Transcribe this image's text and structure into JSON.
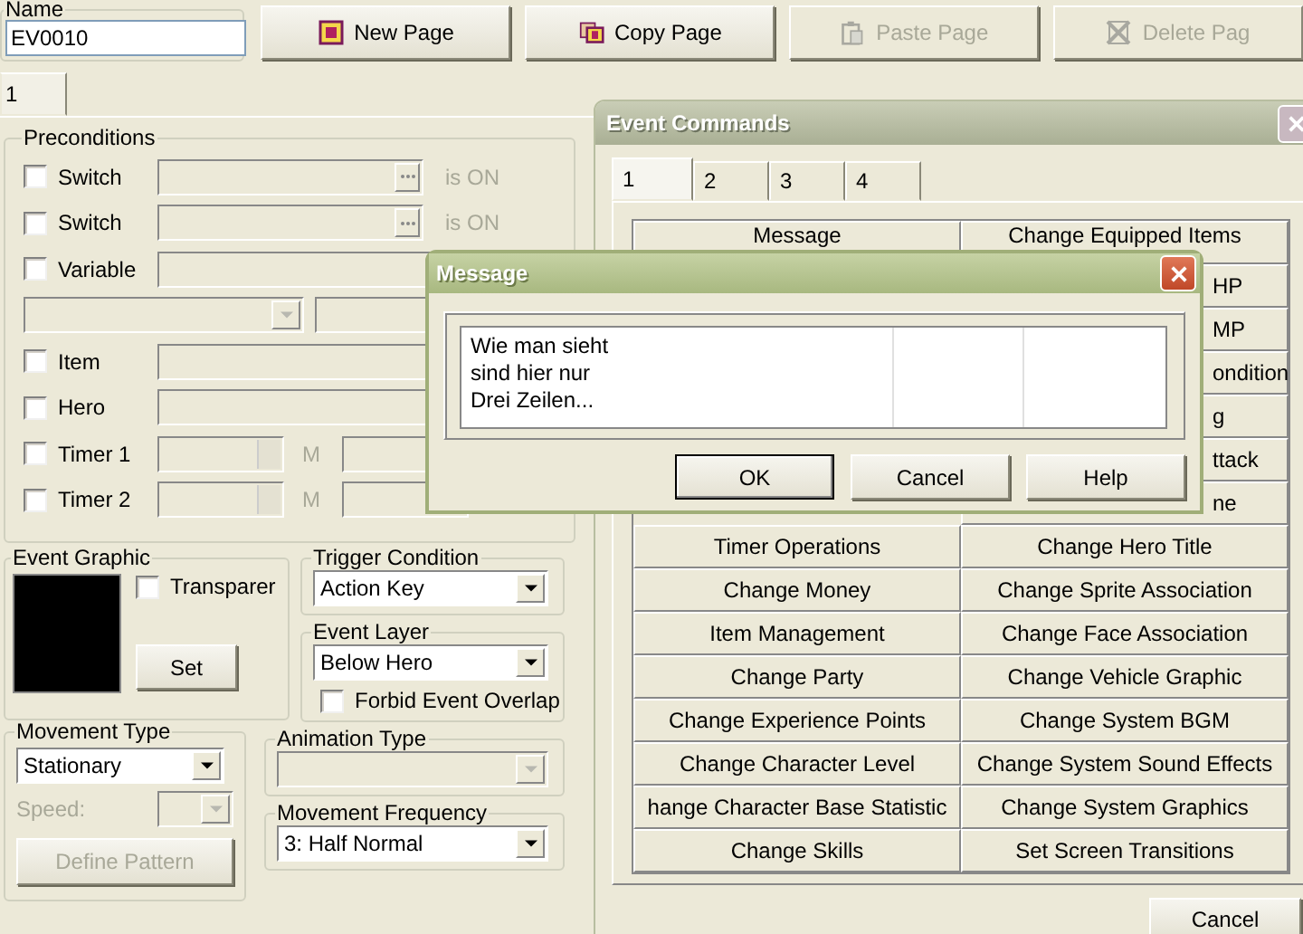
{
  "editor": {
    "name_label": "Name",
    "name_value": "EV0010",
    "toolbar": [
      {
        "label": "New Page",
        "disabled": false
      },
      {
        "label": "Copy Page",
        "disabled": false
      },
      {
        "label": "Paste Page",
        "disabled": true
      },
      {
        "label": "Delete Pag",
        "disabled": true
      }
    ],
    "page_tabs": [
      {
        "label": "1",
        "selected": true
      }
    ],
    "preconditions": {
      "title": "Preconditions",
      "rows": [
        {
          "kind": "switch",
          "label": "Switch",
          "checked": false,
          "suffix": "is ON"
        },
        {
          "kind": "switch",
          "label": "Switch",
          "checked": false,
          "suffix": "is ON"
        },
        {
          "kind": "field",
          "label": "Variable",
          "checked": false
        },
        {
          "kind": "compare"
        },
        {
          "kind": "field",
          "label": "Item",
          "checked": false
        },
        {
          "kind": "field",
          "label": "Hero",
          "checked": false
        },
        {
          "kind": "timer",
          "label": "Timer 1",
          "checked": false,
          "unit": "M"
        },
        {
          "kind": "timer",
          "label": "Timer 2",
          "checked": false,
          "unit": "M"
        }
      ]
    },
    "event_graphic": {
      "title": "Event Graphic",
      "transparent_label": "Transparer",
      "transparent_checked": false,
      "set_label": "Set"
    },
    "trigger_condition": {
      "title": "Trigger Condition",
      "value": "Action Key"
    },
    "event_layer": {
      "title": "Event Layer",
      "value": "Below Hero",
      "overlap_label": "Forbid Event Overlap",
      "overlap_checked": false
    },
    "movement_type": {
      "title": "Movement Type",
      "value": "Stationary",
      "speed_label": "Speed:",
      "pattern_label": "Define Pattern"
    },
    "animation_type": {
      "title": "Animation Type"
    },
    "movement_frequency": {
      "title": "Movement Frequency",
      "value": "3: Half Normal"
    }
  },
  "event_commands": {
    "title": "Event Commands",
    "tabs": [
      {
        "label": "1",
        "selected": true
      },
      {
        "label": "2",
        "selected": false
      },
      {
        "label": "3",
        "selected": false
      },
      {
        "label": "4",
        "selected": false
      }
    ],
    "rows": [
      {
        "left": "Message",
        "right": "Change Equipped Items"
      },
      {
        "right": "HP"
      },
      {
        "right": "MP"
      },
      {
        "right": "ondition"
      },
      {
        "right": "g"
      },
      {
        "right": "ttack"
      },
      {
        "right": "ne"
      },
      {
        "left": "Timer Operations",
        "right": "Change Hero Title"
      },
      {
        "left": "Change Money",
        "right": "Change Sprite Association"
      },
      {
        "left": "Item Management",
        "right": "Change Face Association"
      },
      {
        "left": "Change Party",
        "right": "Change Vehicle Graphic"
      },
      {
        "left": "Change Experience Points",
        "right": "Change System BGM"
      },
      {
        "left": "Change Character Level",
        "right": "Change System Sound Effects"
      },
      {
        "left": "hange Character Base Statistic",
        "right": "Change System Graphics"
      },
      {
        "left": "Change Skills",
        "right": "Set Screen Transitions"
      }
    ],
    "cancel": "Cancel"
  },
  "message_dialog": {
    "title": "Message",
    "lines": [
      "Wie man sieht",
      "sind hier nur",
      "Drei Zeilen..."
    ],
    "buttons": [
      {
        "label": "OK",
        "default": true
      },
      {
        "label": "Cancel",
        "default": false
      },
      {
        "label": "Help",
        "default": false
      }
    ]
  }
}
